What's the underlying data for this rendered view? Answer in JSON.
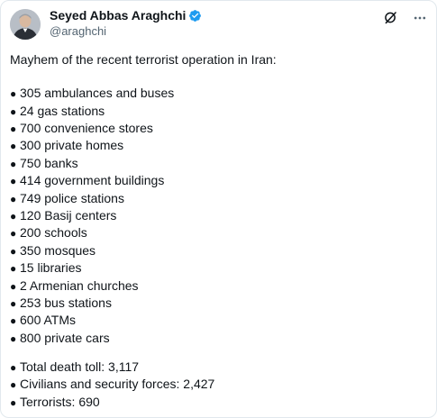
{
  "author": {
    "display_name": "Seyed Abbas Araghchi",
    "handle": "@araghchi",
    "verified": true,
    "verified_color": "#1d9bf0"
  },
  "icons": {
    "verified": "verified-badge-icon",
    "grok": "grok-icon",
    "more": "more-icon"
  },
  "tweet": {
    "intro": "Mayhem of the recent terrorist operation in Iran:",
    "damage_items": [
      "305 ambulances and buses",
      "24 gas stations",
      "700 convenience stores",
      "300 private homes",
      "750 banks",
      "414 government buildings",
      "749 police stations",
      "120 Basij centers",
      "200 schools",
      "350 mosques",
      "15 libraries",
      "2 Armenian churches",
      "253 bus stations",
      "600 ATMs",
      "800 private cars"
    ],
    "casualty_items": [
      "Total death toll: 3,117",
      "Civilians and security forces: 2,427",
      "Terrorists: 690"
    ],
    "bullet": "●"
  }
}
